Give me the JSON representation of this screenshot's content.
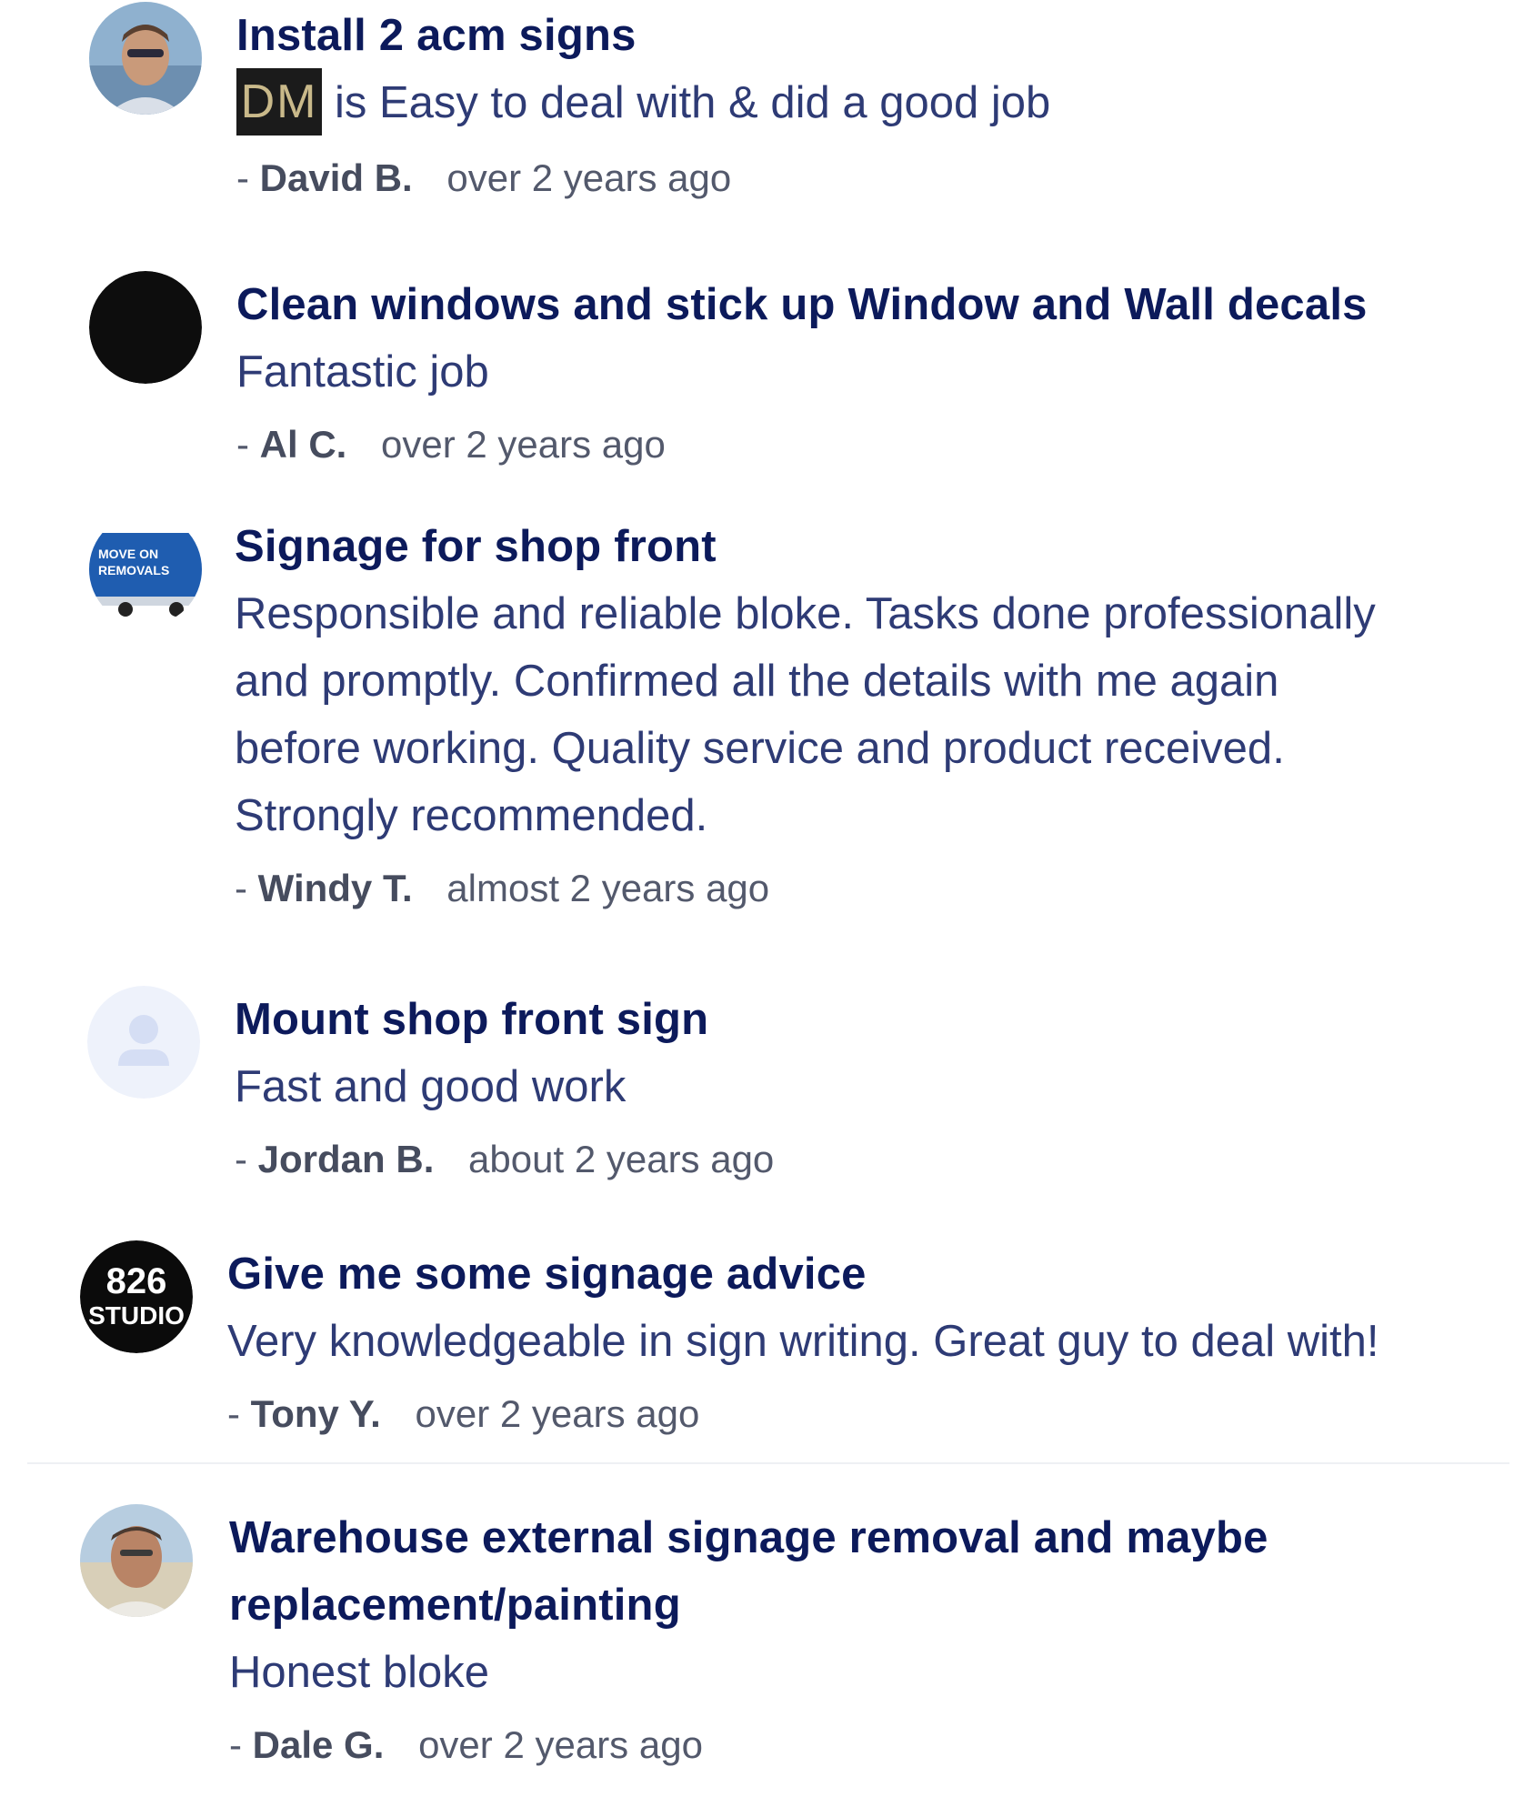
{
  "reviews": [
    {
      "title": "Install 2 acm signs",
      "badge": "DM",
      "body": "is Easy to deal with & did a good job",
      "dash": "-",
      "author": "David B.",
      "time": "over 2 years ago",
      "avatar": "photo-man-sunglasses"
    },
    {
      "title": "Clean windows and stick up Window and Wall decals",
      "body": "Fantastic job",
      "dash": "-",
      "author": "Al C.",
      "time": "over 2 years ago",
      "avatar": "black-circle"
    },
    {
      "title": "Signage for shop front",
      "body_lines": [
        "Responsible and reliable bloke. Tasks done professionally",
        "and promptly. Confirmed all the details with me again",
        "before working. Quality service and product received.",
        "Strongly recommended."
      ],
      "dash": "-",
      "author": "Windy T.",
      "time": "almost 2 years ago",
      "avatar": "move-on-removals-truck",
      "avatar_text": [
        "MOVE ON",
        "REMOVALS"
      ]
    },
    {
      "title": "Mount shop front sign",
      "body": "Fast and good work",
      "dash": "-",
      "author": "Jordan B.",
      "time": "about 2 years ago",
      "avatar": "default-user-icon"
    },
    {
      "title": "Give me some signage advice",
      "body": "Very knowledgeable in sign writing. Great guy to deal with!",
      "dash": "-",
      "author": "Tony Y.",
      "time": "over 2 years ago",
      "avatar": "826-studio-logo",
      "avatar_text": [
        "826",
        "STUDIO"
      ]
    },
    {
      "title_lines": [
        "Warehouse external signage removal and maybe",
        "replacement/painting"
      ],
      "body": "Honest bloke",
      "dash": "-",
      "author": "Dale G.",
      "time": "over 2 years ago",
      "avatar": "photo-man-beach"
    }
  ],
  "colors": {
    "title": "#0c1a5b",
    "body": "#2e3b75",
    "meta": "#53596c",
    "placeholder_avatar_bg": "#eef2fb",
    "placeholder_avatar_icon": "#d5def4"
  }
}
